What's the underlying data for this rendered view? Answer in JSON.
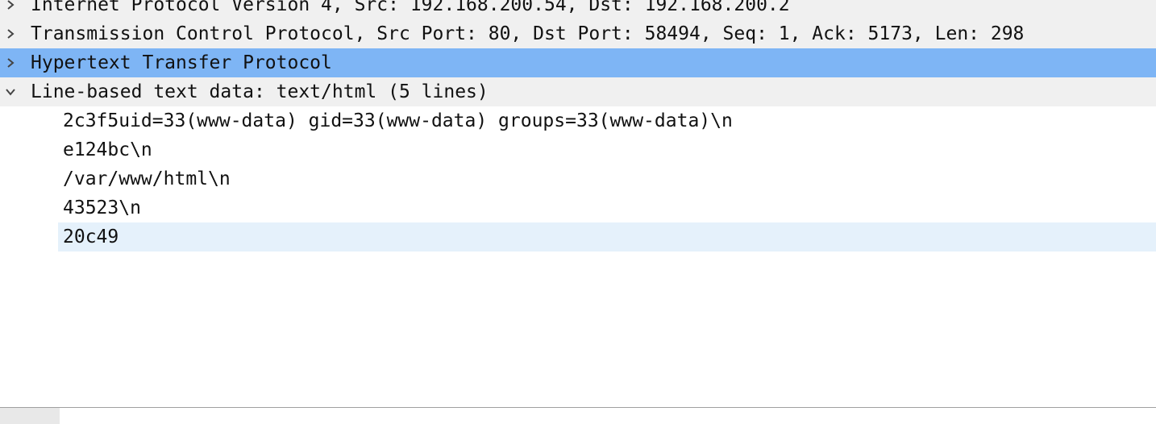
{
  "packet_details": {
    "rows": [
      {
        "label": "Internet Protocol Version 4, Src: 192.168.200.54, Dst: 192.168.200.2",
        "state": "collapsed"
      },
      {
        "label": "Transmission Control Protocol, Src Port: 80, Dst Port: 58494, Seq: 1, Ack: 5173, Len: 298",
        "state": "collapsed"
      },
      {
        "label": "Hypertext Transfer Protocol",
        "state": "collapsed",
        "selected": true
      },
      {
        "label": "Line-based text data: text/html (5 lines)",
        "state": "expanded"
      }
    ],
    "text_lines": [
      "2c3f5uid=33(www-data) gid=33(www-data) groups=33(www-data)\\n",
      "e124bc\\n",
      "/var/www/html\\n",
      "43523\\n",
      "20c49"
    ]
  },
  "colors": {
    "selected_row": "#7eb5f5",
    "parent_row": "#f0f0f0",
    "highlight_child": "#e5f1fb"
  },
  "icons": {
    "collapsed": "chevron-right-icon",
    "expanded": "chevron-down-icon"
  }
}
